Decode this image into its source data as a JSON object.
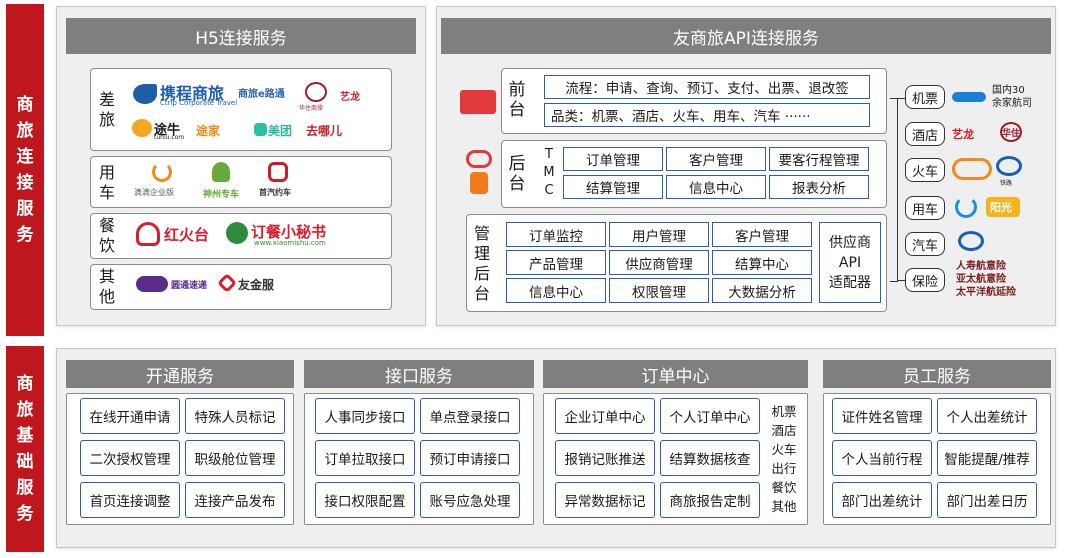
{
  "side_top": [
    "商",
    "旅",
    "连",
    "接",
    "服",
    "务"
  ],
  "side_bottom": [
    "商",
    "旅",
    "基",
    "础",
    "服",
    "务"
  ],
  "h5": {
    "title": "H5连接服务",
    "rows": [
      {
        "label": [
          "差",
          "旅"
        ],
        "logos": [
          "携程商旅",
          "Ctrip Corporate Travel",
          "商旅e路通",
          "华住商旅",
          "艺龙",
          "途牛",
          "tuniu.com",
          "途家",
          "美团",
          "去哪儿"
        ]
      },
      {
        "label": [
          "用",
          "车"
        ],
        "logos": [
          "滴滴企业版",
          "神州专车",
          "首汽约车"
        ]
      },
      {
        "label": [
          "餐",
          "饮"
        ],
        "logos": [
          "红火台",
          "订餐小秘书",
          "www.xiaomishu.com"
        ]
      },
      {
        "label": [
          "其",
          "他"
        ],
        "logos": [
          "圆通速递",
          "友金服"
        ]
      }
    ]
  },
  "api": {
    "title": "友商旅API连接服务",
    "front": {
      "label": [
        "前",
        "台"
      ],
      "flow": "流程：申请、查询、预订、支付、出票、退改签",
      "category": "品类：机票、酒店、火车、用车、汽车 ······"
    },
    "back": {
      "label": [
        "后",
        "台"
      ],
      "tmc": [
        "T",
        "M",
        "C"
      ],
      "cells": [
        "订单管理",
        "客户管理",
        "要客行程管理",
        "结算管理",
        "信息中心",
        "报表分析"
      ]
    },
    "mgmt": {
      "label": [
        "管",
        "理",
        "后",
        "台"
      ],
      "cells": [
        "订单监控",
        "用户管理",
        "客户管理",
        "产品管理",
        "供应商管理",
        "结算中心",
        "信息中心",
        "权限管理",
        "大数据分析"
      ],
      "adapter": [
        "供应商",
        "API",
        "适配器"
      ]
    },
    "suppliers": [
      {
        "name": "机票",
        "logos": [
          "国内30",
          "余家航司"
        ]
      },
      {
        "name": "酒店",
        "logos": [
          "艺龙",
          "华住"
        ]
      },
      {
        "name": "火车",
        "logos": [
          "铁路"
        ]
      },
      {
        "name": "用车",
        "logos": [
          "阳光"
        ]
      },
      {
        "name": "汽车",
        "logos": []
      },
      {
        "name": "保险",
        "logos": [
          "人寿航意险",
          "亚太航意险",
          "太平洋航延险"
        ]
      }
    ]
  },
  "base": {
    "sections": [
      {
        "title": "开通服务",
        "cells": [
          "在线开通申请",
          "特殊人员标记",
          "二次授权管理",
          "职级舱位管理",
          "首页连接调整",
          "连接产品发布"
        ]
      },
      {
        "title": "接口服务",
        "cells": [
          "人事同步接口",
          "单点登录接口",
          "订单拉取接口",
          "预订申请接口",
          "接口权限配置",
          "账号应急处理"
        ]
      },
      {
        "title": "订单中心",
        "cells": [
          "企业订单中心",
          "个人订单中心",
          "报销记账推送",
          "结算数据核查",
          "异常数据标记",
          "商旅报告定制"
        ],
        "side": [
          "机票",
          "酒店",
          "火车",
          "出行",
          "餐饮",
          "其他"
        ]
      },
      {
        "title": "员工服务",
        "cells": [
          "证件姓名管理",
          "个人出差统计",
          "个人当前行程",
          "智能提醒/推荐",
          "部门出差统计",
          "部门出差日历"
        ]
      }
    ]
  },
  "colors": {
    "red": "#c0161d",
    "blue": "#2f5da8",
    "gray": "#7f7f7f",
    "panel": "#efefef"
  }
}
